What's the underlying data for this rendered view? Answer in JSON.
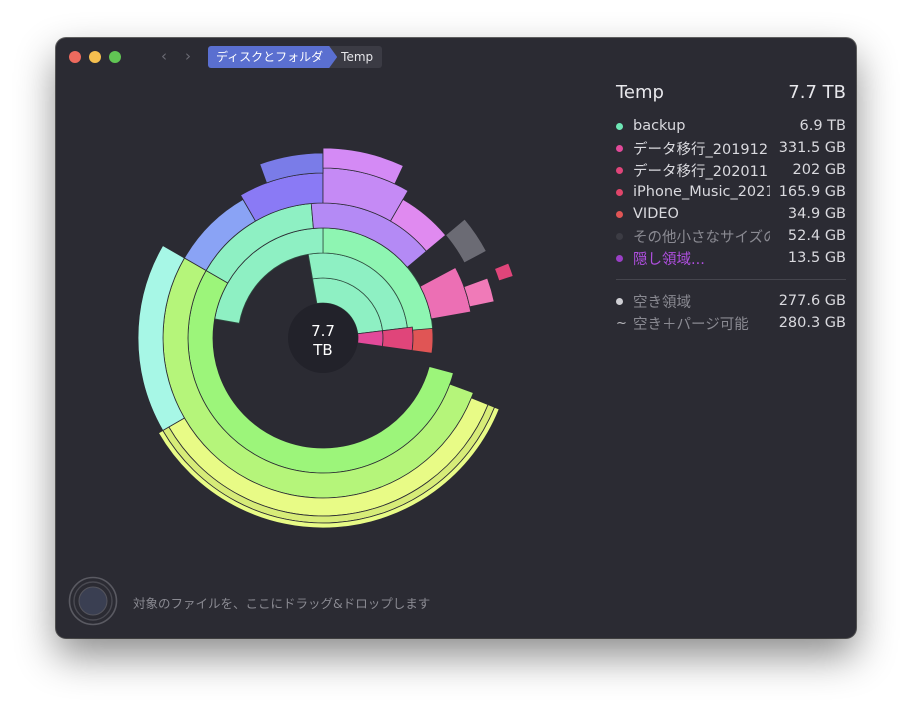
{
  "breadcrumb": {
    "item1": "ディスクとフォルダ",
    "item2": "Temp"
  },
  "center": {
    "line1": "7.7",
    "line2": "TB"
  },
  "panel": {
    "title": "Temp",
    "total": "7.7 TB",
    "items": [
      {
        "name": "backup",
        "size": "6.9 TB",
        "color": "#6ee6b5"
      },
      {
        "name": "データ移行_201912",
        "size": "331.5 GB",
        "color": "#e24a9a"
      },
      {
        "name": "データ移行_202011",
        "size": "202   GB",
        "color": "#e0457a"
      },
      {
        "name": "iPhone_Music_2021",
        "size": "165.9 GB",
        "color": "#e0456a"
      },
      {
        "name": "VIDEO",
        "size": "34.9 GB",
        "color": "#e05555"
      },
      {
        "name": "その他小さなサイズの",
        "size": "52.4 GB",
        "color": "#3c3c44"
      },
      {
        "name": "隠し領域...",
        "size": "13.5 GB",
        "color": "#9a3fc6"
      }
    ],
    "free_label": "空き領域",
    "free_value": "277.6 GB",
    "purge_label": "空き＋パージ可能",
    "purge_value": "280.3 GB"
  },
  "dropzone": {
    "text": "対象のファイルを、ここにドラッグ&ドロップします"
  },
  "colors": {
    "window_bg": "#2b2b33",
    "accent": "#5a6fd0"
  }
}
